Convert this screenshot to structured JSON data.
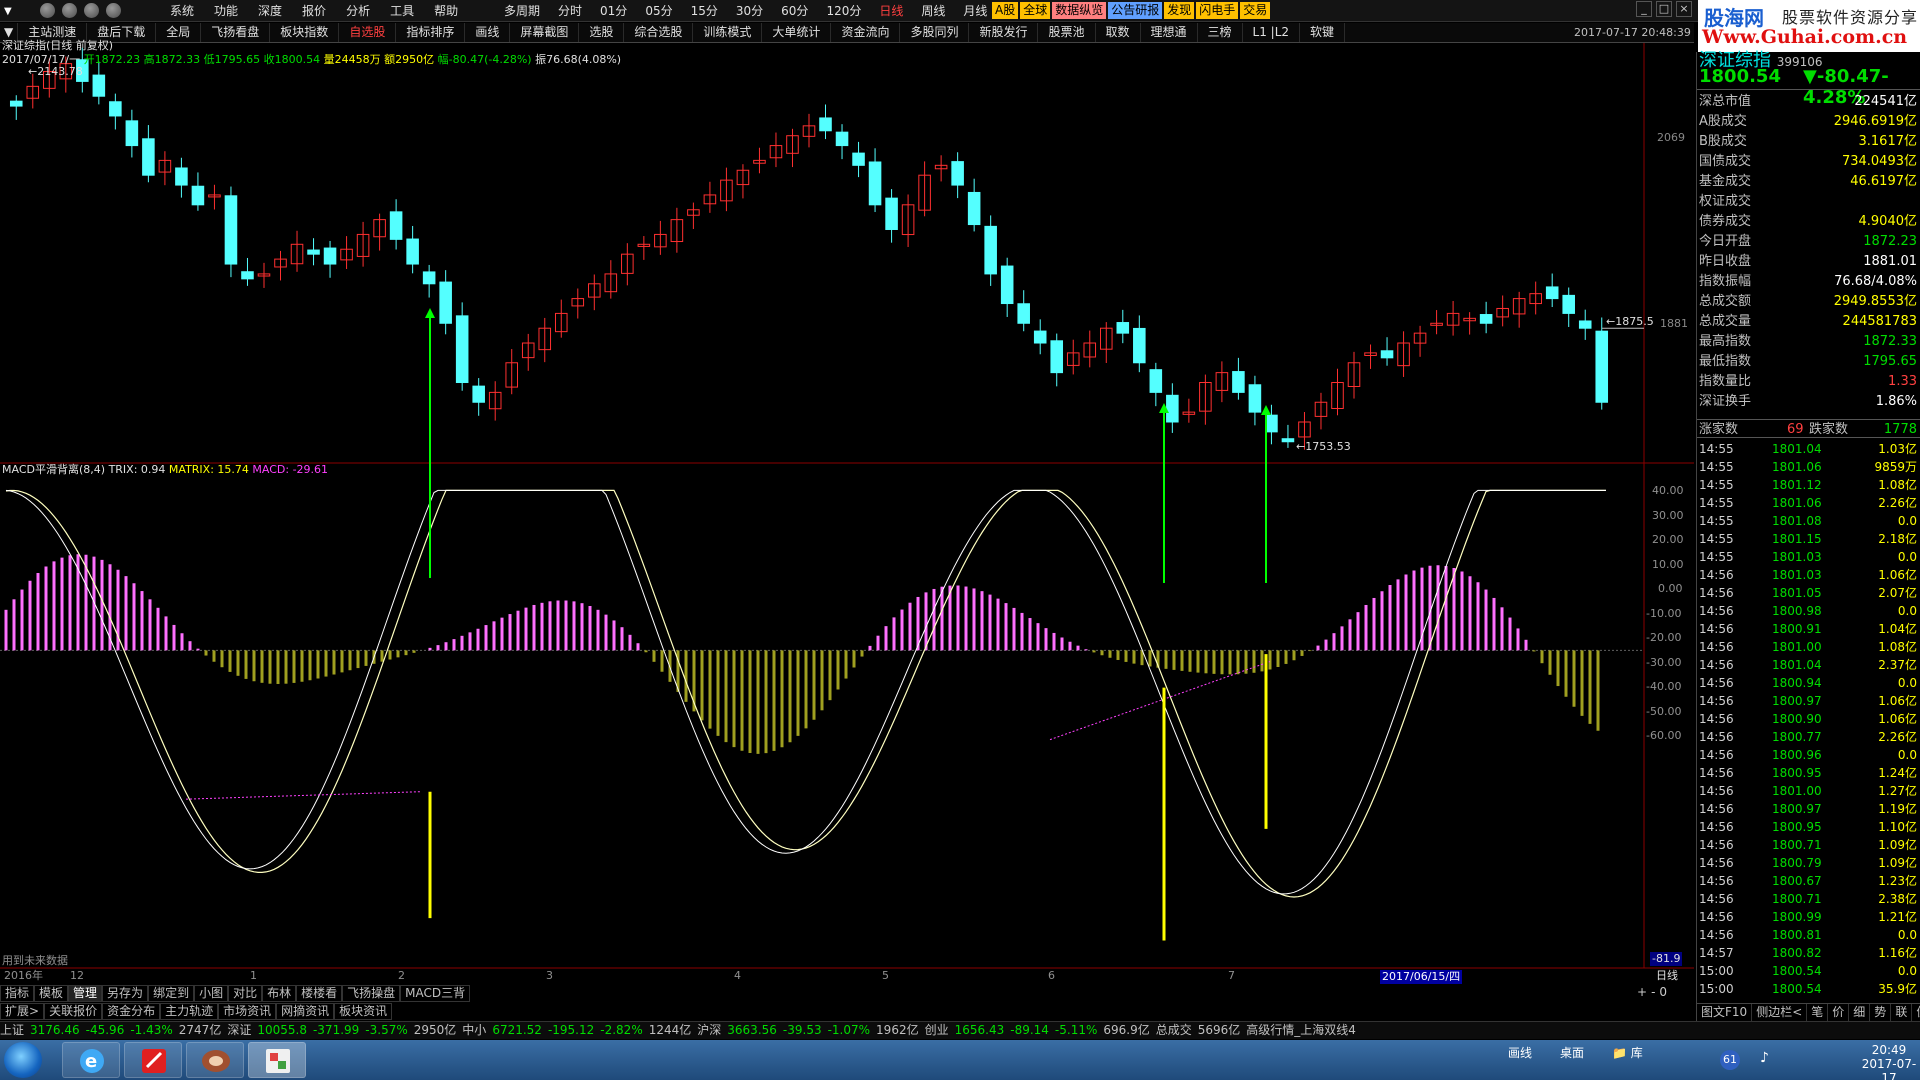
{
  "titlebar": {
    "menu": [
      "系统",
      "功能",
      "深度",
      "报价",
      "分析",
      "工具",
      "帮助"
    ],
    "periods": [
      "多周期",
      "分时",
      "01分",
      "05分",
      "15分",
      "30分",
      "60分",
      "120分",
      "日线",
      "周线",
      "月线"
    ],
    "active_period": "日线",
    "tags": [
      {
        "label": "A股",
        "color": "#ffc000"
      },
      {
        "label": "全球",
        "color": "#ffc000"
      },
      {
        "label": "数据纵览",
        "color": "#ff8080"
      },
      {
        "label": "公告研报",
        "color": "#60a0ff"
      },
      {
        "label": "发现",
        "color": "#ffc000"
      },
      {
        "label": "闪电手",
        "color": "#ffc000"
      },
      {
        "label": "交易",
        "color": "#ffc000"
      }
    ]
  },
  "logo": {
    "line1": "股海网",
    "line1b": "股票软件资源分享",
    "line2": "Www.Guhai.com.cn"
  },
  "toolbar": {
    "items": [
      "主站测速",
      "盘后下载",
      "全局",
      "飞扬看盘",
      "板块指数",
      "自选股",
      "指标排序",
      "画线",
      "屏幕截图",
      "选股",
      "综合选股",
      "训练模式",
      "大单统计",
      "资金流向",
      "多股同列",
      "新股发行",
      "股票池",
      "取数",
      "理想通",
      "三榜",
      "L1 |L2",
      "软键"
    ],
    "active": "自选股",
    "datetime": "2017-07-17  20:48:39"
  },
  "chart": {
    "title": "深证综指(日线 前复权)",
    "ohlc": {
      "date": "2017/07/17/一",
      "open": "开1872.23",
      "high": "高1872.33",
      "low": "低1795.65",
      "close": "收1800.54",
      "volume": "量24458万",
      "amount": "额2950亿",
      "change": "幅-80.47(-4.28%)",
      "amplitude": "振76.68(4.08%)"
    },
    "high_label": "2143.78",
    "low_label": "1753.53",
    "right_labels": [
      "2069",
      "1881"
    ],
    "last_price_label": "1875.5",
    "macd_legend": {
      "name": "MACD平滑背离(8,4)",
      "trix": "TRIX: 0.94",
      "matrix": "MATRIX: 15.74",
      "macd": "MACD: -29.61"
    },
    "macd_axis": [
      "40.00",
      "30.00",
      "20.00",
      "10.00",
      "0.00",
      "-10.00",
      "-20.00",
      "-30.00",
      "-40.00",
      "-50.00",
      "-60.00"
    ],
    "macd_last": "-81.9",
    "note": "用到未来数据",
    "x_labels": [
      "2016年",
      "12",
      "1",
      "2",
      "3",
      "4",
      "5",
      "6",
      "7"
    ],
    "date_highlight": "2017/06/15/四",
    "period_label": "日线",
    "page_buttons": [
      "+",
      "-",
      "0"
    ]
  },
  "chart_data": {
    "type": "candlestick",
    "title": "深证综指(日线 前复权)",
    "price_range": [
      1753.53,
      2143.78
    ],
    "closes_approx": [
      2100,
      2120,
      2135,
      2143,
      2125,
      2110,
      2090,
      2060,
      2030,
      2045,
      2020,
      2000,
      2010,
      1940,
      1925,
      1930,
      1945,
      1960,
      1950,
      1940,
      1955,
      1970,
      1985,
      1965,
      1940,
      1920,
      1880,
      1820,
      1800,
      1810,
      1840,
      1860,
      1875,
      1890,
      1905,
      1920,
      1930,
      1950,
      1960,
      1970,
      1985,
      1995,
      2010,
      2025,
      2035,
      2045,
      2060,
      2070,
      2080,
      2075,
      2060,
      2040,
      2000,
      1975,
      2000,
      2030,
      2040,
      2020,
      1980,
      1930,
      1900,
      1880,
      1860,
      1830,
      1850,
      1860,
      1875,
      1870,
      1840,
      1810,
      1780,
      1790,
      1820,
      1830,
      1810,
      1790,
      1770,
      1760,
      1780,
      1800,
      1820,
      1840,
      1850,
      1845,
      1860,
      1870,
      1880,
      1890,
      1885,
      1880,
      1895,
      1905,
      1910,
      1905,
      1890,
      1875,
      1800
    ],
    "macd_range": [
      -81.9,
      45
    ]
  },
  "right_panel": {
    "header_name": "深证综指",
    "header_code": "399106",
    "header_price": "1800.54",
    "header_change": "▼-80.47-4.28%",
    "stats": [
      {
        "k": "深总市值",
        "v": "224541亿",
        "color": "#ffffff"
      },
      {
        "k": "A股成交",
        "v": "2946.6919亿",
        "color": "#ffff00"
      },
      {
        "k": "B股成交",
        "v": "3.1617亿",
        "color": "#ffff00"
      },
      {
        "k": "国债成交",
        "v": "734.0493亿",
        "color": "#ffff00"
      },
      {
        "k": "基金成交",
        "v": "46.6197亿",
        "color": "#ffff00"
      },
      {
        "k": "权证成交",
        "v": "",
        "color": "#ffff00"
      },
      {
        "k": "债券成交",
        "v": "4.9040亿",
        "color": "#ffff00"
      },
      {
        "k": "今日开盘",
        "v": "1872.23",
        "color": "#00dd00"
      },
      {
        "k": "昨日收盘",
        "v": "1881.01",
        "color": "#ffffff"
      },
      {
        "k": "指数振幅",
        "v": "76.68/4.08%",
        "color": "#ffffff"
      },
      {
        "k": "总成交额",
        "v": "2949.8553亿",
        "color": "#ffff00"
      },
      {
        "k": "总成交量",
        "v": "244581783",
        "color": "#ffff00"
      },
      {
        "k": "最高指数",
        "v": "1872.33",
        "color": "#00dd00"
      },
      {
        "k": "最低指数",
        "v": "1795.65",
        "color": "#00dd00"
      },
      {
        "k": "指数量比",
        "v": "1.33",
        "color": "#ff4040"
      },
      {
        "k": "深证换手",
        "v": "1.86%",
        "color": "#ffffff"
      }
    ],
    "up_label": "涨家数",
    "up_count": "69",
    "down_label": "跌家数",
    "down_count": "1778",
    "ticks": [
      {
        "t": "14:55",
        "p": "1801.04",
        "a": "1.03亿"
      },
      {
        "t": "14:55",
        "p": "1801.06",
        "a": "9859万"
      },
      {
        "t": "14:55",
        "p": "1801.12",
        "a": "1.08亿"
      },
      {
        "t": "14:55",
        "p": "1801.06",
        "a": "2.26亿"
      },
      {
        "t": "14:55",
        "p": "1801.08",
        "a": "0.0"
      },
      {
        "t": "14:55",
        "p": "1801.15",
        "a": "2.18亿"
      },
      {
        "t": "14:55",
        "p": "1801.03",
        "a": "0.0"
      },
      {
        "t": "14:56",
        "p": "1801.03",
        "a": "1.06亿"
      },
      {
        "t": "14:56",
        "p": "1801.05",
        "a": "2.07亿"
      },
      {
        "t": "14:56",
        "p": "1800.98",
        "a": "0.0"
      },
      {
        "t": "14:56",
        "p": "1800.91",
        "a": "1.04亿"
      },
      {
        "t": "14:56",
        "p": "1801.00",
        "a": "1.08亿"
      },
      {
        "t": "14:56",
        "p": "1801.04",
        "a": "2.37亿"
      },
      {
        "t": "14:56",
        "p": "1800.94",
        "a": "0.0"
      },
      {
        "t": "14:56",
        "p": "1800.97",
        "a": "1.06亿"
      },
      {
        "t": "14:56",
        "p": "1800.90",
        "a": "1.06亿"
      },
      {
        "t": "14:56",
        "p": "1800.77",
        "a": "2.26亿"
      },
      {
        "t": "14:56",
        "p": "1800.96",
        "a": "0.0"
      },
      {
        "t": "14:56",
        "p": "1800.95",
        "a": "1.24亿"
      },
      {
        "t": "14:56",
        "p": "1801.00",
        "a": "1.27亿"
      },
      {
        "t": "14:56",
        "p": "1800.97",
        "a": "1.19亿"
      },
      {
        "t": "14:56",
        "p": "1800.95",
        "a": "1.10亿"
      },
      {
        "t": "14:56",
        "p": "1800.71",
        "a": "1.09亿"
      },
      {
        "t": "14:56",
        "p": "1800.79",
        "a": "1.09亿"
      },
      {
        "t": "14:56",
        "p": "1800.67",
        "a": "1.23亿"
      },
      {
        "t": "14:56",
        "p": "1800.71",
        "a": "2.38亿"
      },
      {
        "t": "14:56",
        "p": "1800.99",
        "a": "1.21亿"
      },
      {
        "t": "14:56",
        "p": "1800.81",
        "a": "0.0"
      },
      {
        "t": "14:57",
        "p": "1800.82",
        "a": "1.16亿"
      },
      {
        "t": "15:00",
        "p": "1800.54",
        "a": "0.0"
      },
      {
        "t": "15:00",
        "p": "1800.54",
        "a": "35.9亿"
      }
    ],
    "bottom_tabs": [
      "图文F10",
      "侧边栏<",
      "笔",
      "价",
      "细",
      "势",
      "联",
      "值",
      "主",
      "筹"
    ]
  },
  "bottom_tabs1": [
    "指标",
    "模板",
    "管理",
    "另存为",
    "绑定到",
    "小图",
    "对比",
    "布林",
    "楼楼看",
    "飞扬操盘",
    "MACD三背"
  ],
  "bottom_tabs2": [
    "扩展>",
    "关联报价",
    "资金分布",
    "主力轨迹",
    "市场资讯",
    "网摘资讯",
    "板块资讯"
  ],
  "statusbar": [
    {
      "text": "上证",
      "color": "#c0c0c0"
    },
    {
      "text": "3176.46",
      "color": "#00dd00"
    },
    {
      "text": "-45.96",
      "color": "#00dd00"
    },
    {
      "text": "-1.43%",
      "color": "#00dd00"
    },
    {
      "text": "2747亿",
      "color": "#c0c0c0"
    },
    {
      "text": "深证",
      "color": "#c0c0c0"
    },
    {
      "text": "10055.8",
      "color": "#00dd00"
    },
    {
      "text": "-371.99",
      "color": "#00dd00"
    },
    {
      "text": "-3.57%",
      "color": "#00dd00"
    },
    {
      "text": "2950亿",
      "color": "#c0c0c0"
    },
    {
      "text": "中小",
      "color": "#c0c0c0"
    },
    {
      "text": "6721.52",
      "color": "#00dd00"
    },
    {
      "text": "-195.12",
      "color": "#00dd00"
    },
    {
      "text": "-2.82%",
      "color": "#00dd00"
    },
    {
      "text": "1244亿",
      "color": "#c0c0c0"
    },
    {
      "text": "沪深",
      "color": "#c0c0c0"
    },
    {
      "text": "3663.56",
      "color": "#00dd00"
    },
    {
      "text": "-39.53",
      "color": "#00dd00"
    },
    {
      "text": "-1.07%",
      "color": "#00dd00"
    },
    {
      "text": "1962亿",
      "color": "#c0c0c0"
    },
    {
      "text": "创业",
      "color": "#c0c0c0"
    },
    {
      "text": "1656.43",
      "color": "#00dd00"
    },
    {
      "text": "-89.14",
      "color": "#00dd00"
    },
    {
      "text": "-5.11%",
      "color": "#00dd00"
    },
    {
      "text": "696.9亿",
      "color": "#c0c0c0"
    },
    {
      "text": "总成交",
      "color": "#c0c0c0"
    },
    {
      "text": "5696亿",
      "color": "#c0c0c0"
    },
    {
      "text": "高级行情_上海双线4",
      "color": "#c0c0c0"
    }
  ],
  "taskbar": {
    "tray_items": [
      "画线",
      "桌面",
      "库"
    ],
    "badge": "61",
    "time": "20:49",
    "date": "2017-07-17"
  }
}
